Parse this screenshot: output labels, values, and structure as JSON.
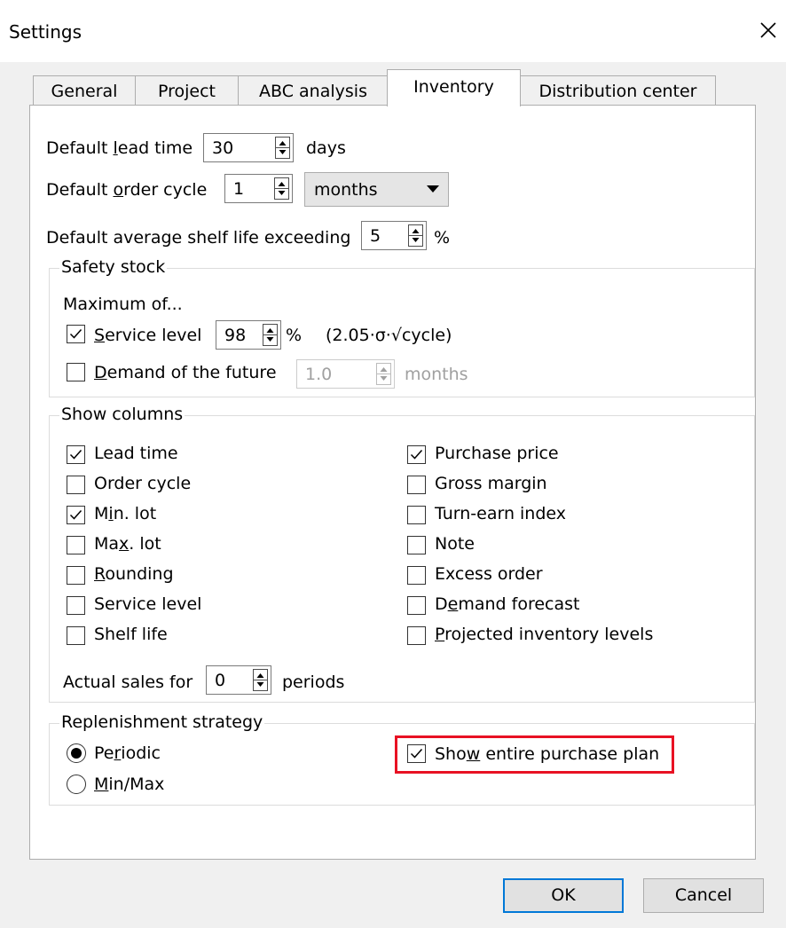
{
  "window": {
    "title": "Settings",
    "close_icon": "close-icon"
  },
  "tabs": [
    {
      "label": "General",
      "active": false
    },
    {
      "label": "Project",
      "active": false
    },
    {
      "label": "ABC analysis",
      "active": false
    },
    {
      "label": "Inventory",
      "active": true
    },
    {
      "label": "Distribution center",
      "active": false
    }
  ],
  "inventory": {
    "lead_time": {
      "pre": "Default ",
      "mnemonic": "l",
      "post": "ead time",
      "value": "30",
      "unit": "days"
    },
    "order_cycle": {
      "pre": "Default ",
      "mnemonic": "o",
      "post": "rder cycle",
      "value": "1",
      "unit": "months"
    },
    "shelf_life": {
      "label": "Default average shelf life exceeding",
      "value": "5",
      "unit": "%"
    }
  },
  "safety_stock": {
    "title": "Safety stock",
    "subtitle": "Maximum of...",
    "service_level": {
      "mnemonic": "S",
      "post": "ervice level",
      "checked": true,
      "value": "98",
      "unit": "%",
      "formula": "(2.05·σ·√cycle)"
    },
    "demand_future": {
      "mnemonic": "D",
      "post": "emand of the future",
      "checked": false,
      "value": "1.0",
      "unit": "months"
    }
  },
  "show_columns": {
    "title": "Show columns",
    "left": [
      {
        "pre": "",
        "mnemonic": "",
        "post": "Lead time",
        "checked": true
      },
      {
        "pre": "",
        "mnemonic": "",
        "post": "Order cycle",
        "checked": false
      },
      {
        "pre": "M",
        "mnemonic": "i",
        "post": "n. lot",
        "checked": true
      },
      {
        "pre": "Ma",
        "mnemonic": "x",
        "post": ". lot",
        "checked": false
      },
      {
        "pre": "",
        "mnemonic": "R",
        "post": "ounding",
        "checked": false
      },
      {
        "pre": "",
        "mnemonic": "",
        "post": "Service level",
        "checked": false
      },
      {
        "pre": "",
        "mnemonic": "",
        "post": "Shelf life",
        "checked": false
      }
    ],
    "right": [
      {
        "pre": "",
        "mnemonic": "",
        "post": "Purchase price",
        "checked": true
      },
      {
        "pre": "",
        "mnemonic": "",
        "post": "Gross margin",
        "checked": false
      },
      {
        "pre": "",
        "mnemonic": "",
        "post": "Turn-earn index",
        "checked": false
      },
      {
        "pre": "",
        "mnemonic": "",
        "post": "Note",
        "checked": false
      },
      {
        "pre": "",
        "mnemonic": "",
        "post": "Excess order",
        "checked": false
      },
      {
        "pre": "D",
        "mnemonic": "e",
        "post": "mand forecast",
        "checked": false
      },
      {
        "pre": "",
        "mnemonic": "P",
        "post": "rojected inventory levels",
        "checked": false
      }
    ],
    "actual_sales": {
      "label": "Actual sales for",
      "value": "0",
      "unit": "periods"
    }
  },
  "replenishment": {
    "title": "Replenishment strategy",
    "periodic": {
      "pre": "Pe",
      "mnemonic": "r",
      "post": "iodic",
      "selected": true
    },
    "minmax": {
      "pre": "",
      "mnemonic": "M",
      "post": "in/Max",
      "selected": false
    },
    "show_plan": {
      "pre": "Sho",
      "mnemonic": "w",
      "post": " entire purchase plan",
      "checked": true
    }
  },
  "buttons": {
    "ok": "OK",
    "cancel": "Cancel"
  },
  "colors": {
    "highlight": "#e81123",
    "default_button": "#0078d7"
  }
}
